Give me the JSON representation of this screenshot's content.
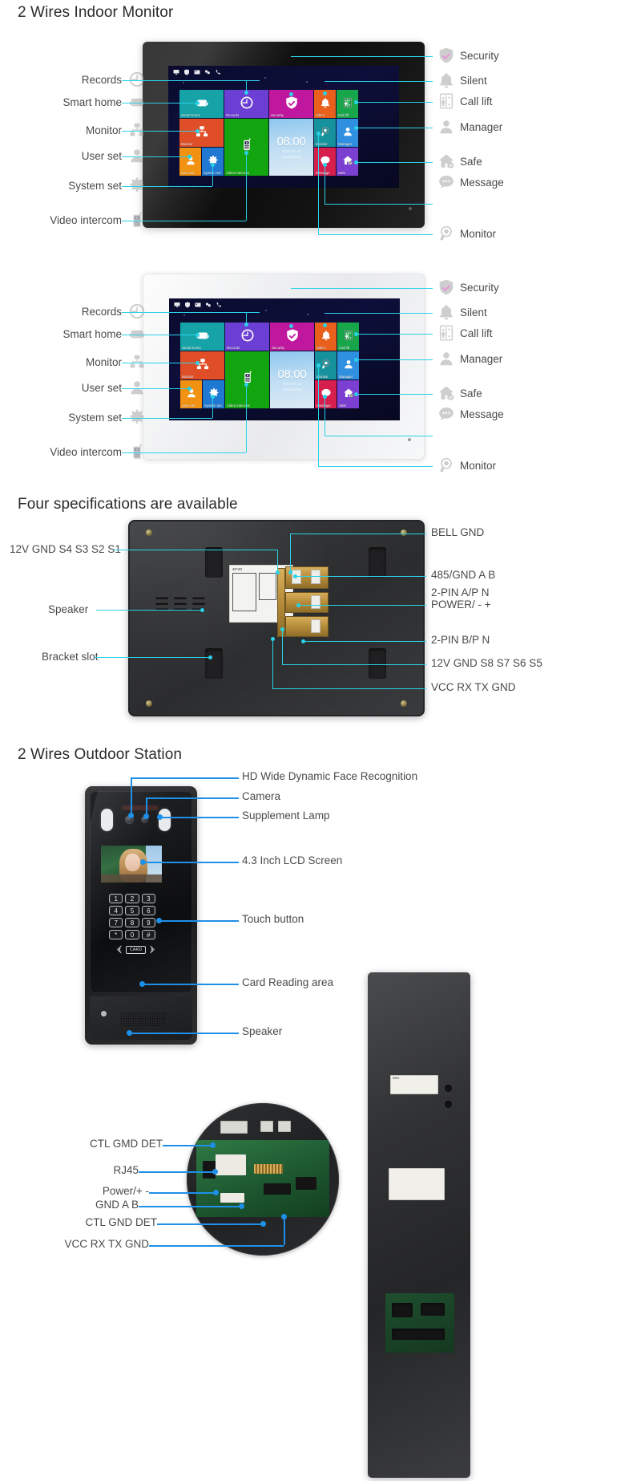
{
  "sections": {
    "indoor_title": "2 Wires Indoor Monitor",
    "specs_title": "Four specifications are available",
    "outdoor_title": "2 Wires Outdoor Station"
  },
  "indoor": {
    "left_labels": [
      {
        "text": "Records",
        "icon": "clock-icon"
      },
      {
        "text": "Smart home",
        "icon": "sofa-icon"
      },
      {
        "text": "Monitor",
        "icon": "network-icon"
      },
      {
        "text": "User set",
        "icon": "user-icon"
      },
      {
        "text": "System set",
        "icon": "gear-icon"
      },
      {
        "text": "Video intercom",
        "icon": "handset-icon"
      }
    ],
    "right_labels": [
      {
        "text": "Security",
        "icon": "shield-check-icon"
      },
      {
        "text": "Silent",
        "icon": "bell-icon"
      },
      {
        "text": "Call lift",
        "icon": "elevator-icon"
      },
      {
        "text": "Manager",
        "icon": "manager-icon"
      },
      {
        "text": "Safe",
        "icon": "home-shield-icon"
      },
      {
        "text": "Message",
        "icon": "chat-icon"
      },
      {
        "text": "Monitor",
        "icon": "camera-icon"
      }
    ],
    "screen": {
      "tiles": [
        {
          "label": "Smart home",
          "icon": "sofa-icon",
          "color": "#15a3a8"
        },
        {
          "label": "Records",
          "icon": "clock-icon",
          "color": "#6b3fd4"
        },
        {
          "label": "Security",
          "icon": "shield-check-icon",
          "color": "#c0179f"
        },
        {
          "label": "Monitor",
          "icon": "network-icon",
          "color": "#e04e28"
        },
        {
          "label": "Video intercom",
          "icon": "handset-icon",
          "color": "#13a50f"
        },
        {
          "label": "User set",
          "icon": "user-icon",
          "color": "#f29212"
        },
        {
          "label": "System set",
          "icon": "gear-icon",
          "color": "#1f78d1"
        },
        {
          "label": "Silent",
          "icon": "bell-icon",
          "color": "#e8601c"
        },
        {
          "label": "Call lift",
          "icon": "elevator-icon",
          "color": "#17a64a"
        },
        {
          "label": "Monitor",
          "icon": "camera-icon",
          "color": "#16929c"
        },
        {
          "label": "Manager",
          "icon": "manager-icon",
          "color": "#2f8fe0"
        },
        {
          "label": "Message",
          "icon": "chat-icon",
          "color": "#d71f4e"
        },
        {
          "label": "Safe",
          "icon": "home-shield-icon",
          "color": "#7b3fd1"
        }
      ],
      "clock": {
        "time": "08:00",
        "date": "2023-02-15",
        "day": "Wednesday"
      },
      "statusbar_icons": [
        "monitor-icon",
        "shield-icon",
        "picture-icon",
        "link-icon",
        "phone-icon"
      ]
    },
    "colors": {
      "leader": "#2ad2e8",
      "leader_blue": "#1e90e8"
    }
  },
  "specs": {
    "left_labels": [
      {
        "text": "12V GND S4 S3 S2 S1"
      },
      {
        "text": "Speaker"
      },
      {
        "text": "Bracket slot"
      }
    ],
    "right_labels": [
      {
        "text": "BELL GND"
      },
      {
        "text": "485/GND A B"
      },
      {
        "text": "2-PIN A/P N"
      },
      {
        "text": "POWER/ - +"
      },
      {
        "text": "2-PIN B/P N"
      },
      {
        "text": "12V GND S8 S7 S6 S5"
      },
      {
        "text": "VCC  RX TX GND"
      }
    ],
    "panel_label": {
      "size": "40*40",
      "pins": "P N"
    }
  },
  "outdoor": {
    "right_labels": [
      {
        "text": "HD Wide Dynamic Face Recognition"
      },
      {
        "text": "Camera"
      },
      {
        "text": "Supplement Lamp"
      },
      {
        "text": "4.3 Inch LCD Screen"
      },
      {
        "text": "Touch button"
      },
      {
        "text": "Card Reading area"
      },
      {
        "text": "Speaker"
      }
    ],
    "keypad": [
      "1",
      "2",
      "3",
      "4",
      "5",
      "6",
      "7",
      "8",
      "9",
      "*",
      "0",
      "#"
    ],
    "card_label": "CARD",
    "pcb_labels": [
      {
        "text": "CTL GMD DET"
      },
      {
        "text": "RJ45"
      },
      {
        "text": "Power/+ -"
      },
      {
        "text": "GND A B"
      },
      {
        "text": "CTL GND DET"
      },
      {
        "text": "VCC RX TX GND"
      }
    ]
  }
}
